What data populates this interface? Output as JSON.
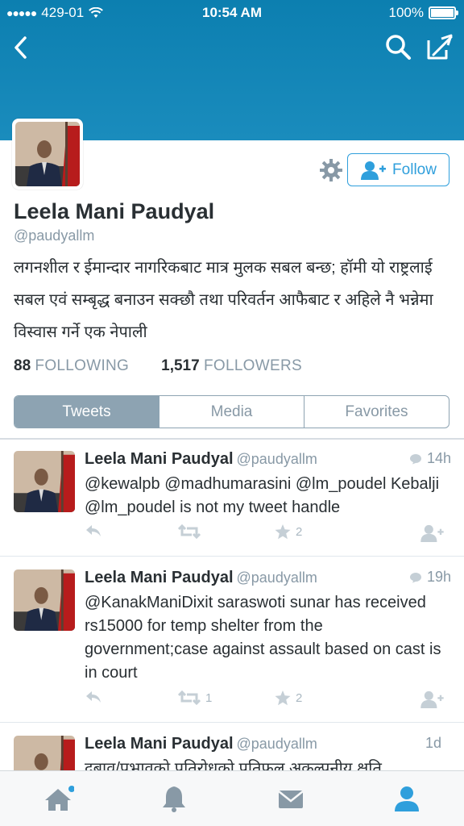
{
  "status_bar": {
    "carrier": "429-01",
    "time": "10:54 AM",
    "battery": "100%"
  },
  "header": {
    "back_icon": "chevron-left-icon",
    "search_icon": "search-icon",
    "compose_icon": "compose-icon"
  },
  "profile": {
    "name": "Leela Mani Paudyal",
    "handle": "@paudyallm",
    "bio": "लगनशील र ईमान्दार नागरिकबाट मात्र मुलक सबल बन्छ; हॉमी यो राष्ट्रलाई सबल एवं सम्बृद्ध बनाउन सक्छौ तथा परिवर्तन आफैबाट र अहिले नै भन्नेमा विस्वास गर्ने एक नेपाली",
    "following_count": "88",
    "following_label": "FOLLOWING",
    "followers_count": "1,517",
    "followers_label": "FOLLOWERS",
    "follow_label": "Follow"
  },
  "tabs": [
    {
      "label": "Tweets",
      "active": true
    },
    {
      "label": "Media",
      "active": false
    },
    {
      "label": "Favorites",
      "active": false
    }
  ],
  "tweets": [
    {
      "name": "Leela Mani Paudyal",
      "handle": "@paudyallm",
      "time": "14h",
      "text": "@kewalpb @madhumarasini @lm_poudel Kebalji @lm_poudel is not my tweet handle",
      "retweets": "",
      "favorites": "2"
    },
    {
      "name": "Leela Mani Paudyal",
      "handle": "@paudyallm",
      "time": "19h",
      "text": "@KanakManiDixit saraswoti sunar has received rs15000 for temp shelter from the government;case against assault based on cast is in court",
      "retweets": "1",
      "favorites": "2"
    },
    {
      "name": "Leela Mani Paudyal",
      "handle": "@paudyallm",
      "time": "1d",
      "text": "दबाव/प्रभावको प्रतिरोधको प्रतिफल अकल्पनीय क्षति",
      "retweets": "",
      "favorites": ""
    }
  ],
  "tab_bar": [
    "home-icon",
    "notifications-icon",
    "messages-icon",
    "me-icon"
  ],
  "colors": {
    "brand_blue": "#2f9fdc",
    "header_blue": "#0c7fb0",
    "tab_active": "#8da3b2"
  }
}
